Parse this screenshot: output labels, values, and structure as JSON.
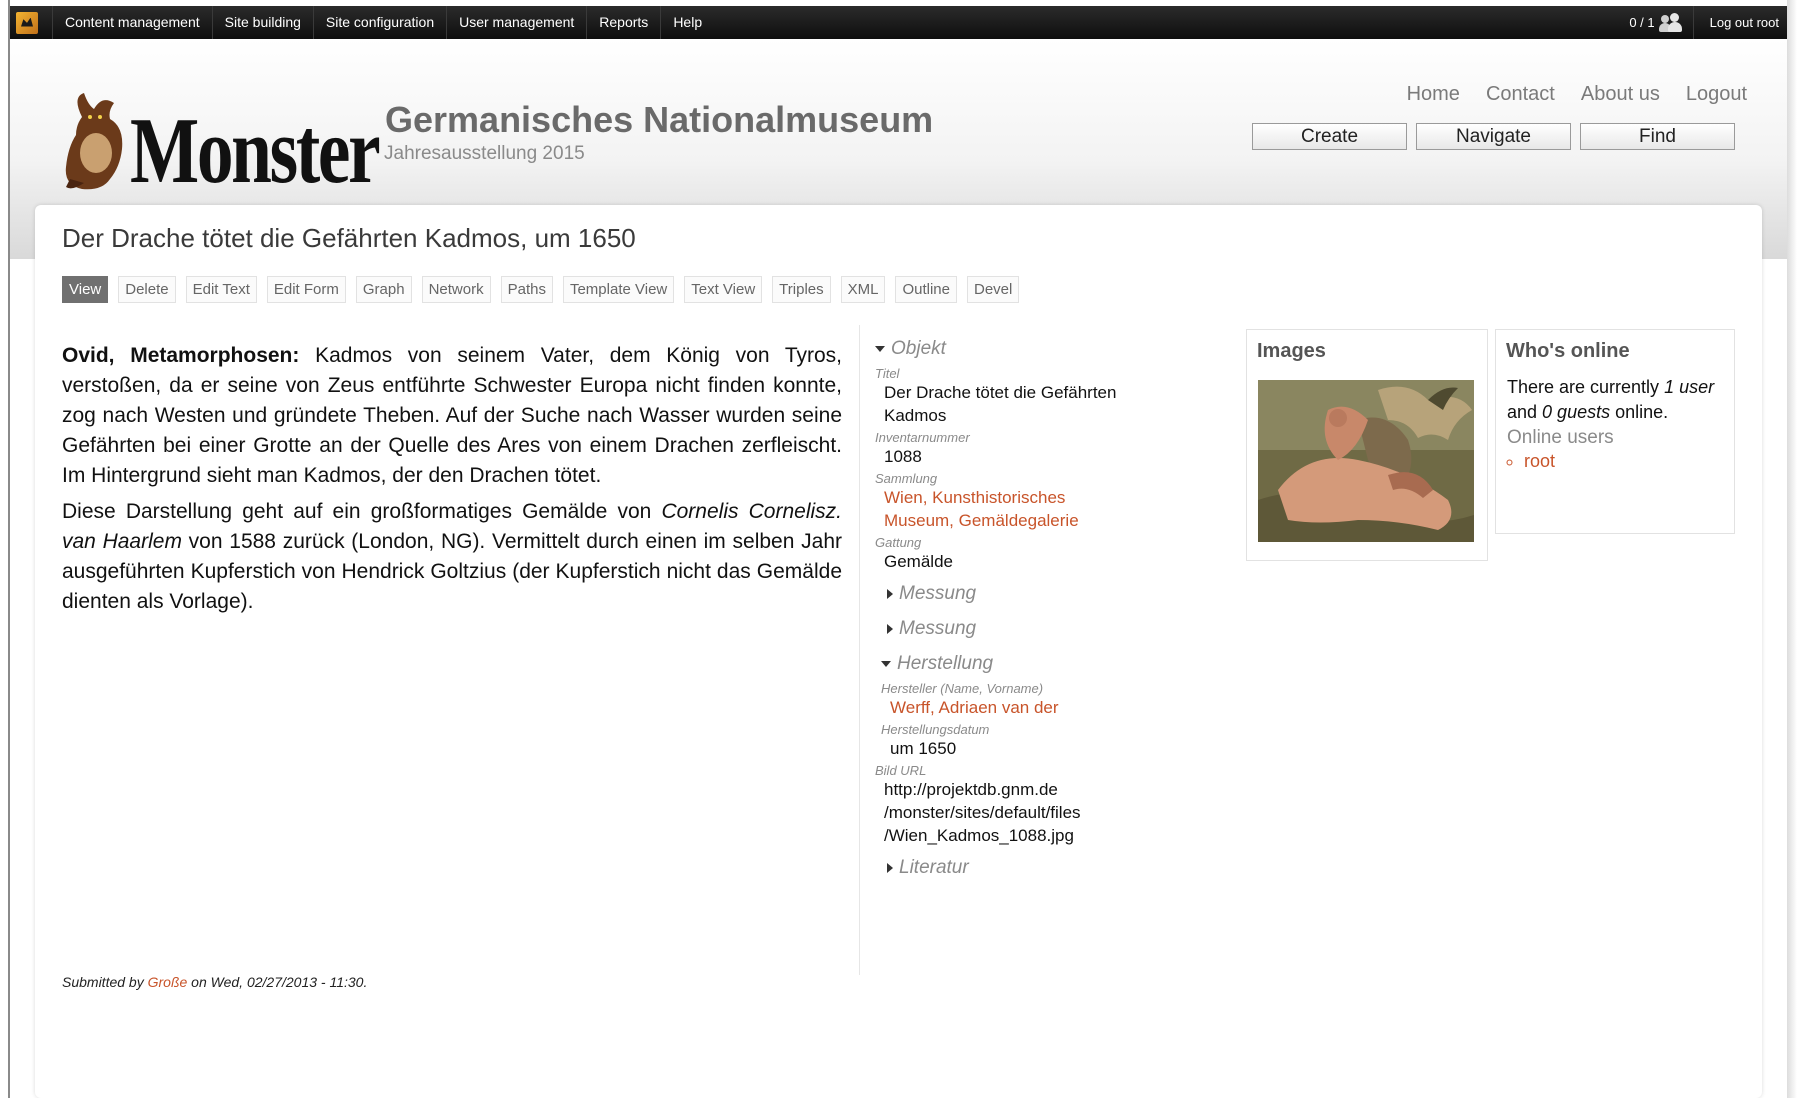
{
  "adminbar": {
    "menu": [
      "Content management",
      "Site building",
      "Site configuration",
      "User management",
      "Reports",
      "Help"
    ],
    "counter": "0 / 1",
    "logout": "Log out root"
  },
  "header": {
    "logo_text": "Monster",
    "site_name": "Germanisches Nationalmuseum",
    "slogan": "Jahresausstellung 2015",
    "secondary_nav": [
      "Home",
      "Contact",
      "About us",
      "Logout"
    ],
    "buttons": [
      "Create",
      "Navigate",
      "Find"
    ]
  },
  "page": {
    "title": "Der Drache tötet die Gefährten Kadmos, um 1650",
    "tabs": [
      "View",
      "Delete",
      "Edit Text",
      "Edit Form",
      "Graph",
      "Network",
      "Paths",
      "Template View",
      "Text View",
      "Triples",
      "XML",
      "Outline",
      "Devel"
    ],
    "active_tab": "View",
    "body": {
      "p1_bold": "Ovid, Metamorphosen:",
      "p1_text": " Kadmos von seinem Vater, dem König von Tyros, verstoßen, da er seine von Zeus entführte Schwester Europa nicht finden konnte, zog nach Westen und gründete Theben. Auf der Suche nach Wasser wurden seine Gefährten bei einer Grotte an der Quelle des Ares von einem Drachen zerfleischt. Im Hintergrund sieht man Kadmos, der den Drachen tötet.",
      "p2_a": "Diese Darstellung geht auf ein großformatiges Gemälde von ",
      "p2_italic": "Cornelis Cornelisz. van Haarlem",
      "p2_b": " von 1588 zurück (London, NG). Vermittelt durch einen im selben Jahr ausgeführten Kupferstich von Hendrick Goltzius (der Kupferstich nicht das Gemälde dienten als Vorlage)."
    },
    "submitted": {
      "prefix": "Submitted by ",
      "author": "Große",
      "suffix": " on Wed, 02/27/2013 - 11:30."
    }
  },
  "fields": {
    "objekt_label": "Objekt",
    "titel_label": "Titel",
    "titel_value": "Der Drache tötet die Gefährten Kadmos",
    "inventar_label": "Inventarnummer",
    "inventar_value": "1088",
    "sammlung_label": "Sammlung",
    "sammlung_value": "Wien, Kunsthistorisches Museum, Gemäldegalerie",
    "gattung_label": "Gattung",
    "gattung_value": "Gemälde",
    "messung1": "Messung",
    "messung2": "Messung",
    "herstellung_label": "Herstellung",
    "hersteller_label": "Hersteller (Name, Vorname)",
    "hersteller_value": "Werff, Adriaen van der",
    "datum_label": "Herstellungsdatum",
    "datum_value": "um 1650",
    "bildurl_label": "Bild URL",
    "bildurl_value": "http://projektdb.gnm.de /monster/sites/default/files /Wien_Kadmos_1088.jpg",
    "literatur": "Literatur"
  },
  "blocks": {
    "images_title": "Images",
    "online_title": "Who's online",
    "online_a": "There are currently ",
    "online_users": "1 user",
    "online_b": " and ",
    "online_guests": "0 guests",
    "online_c": " online.",
    "online_users_label": "Online users",
    "online_list": [
      "root"
    ]
  },
  "colors": {
    "link": "#c8542a",
    "adminbar": "#111111",
    "active_tab": "#707070"
  }
}
